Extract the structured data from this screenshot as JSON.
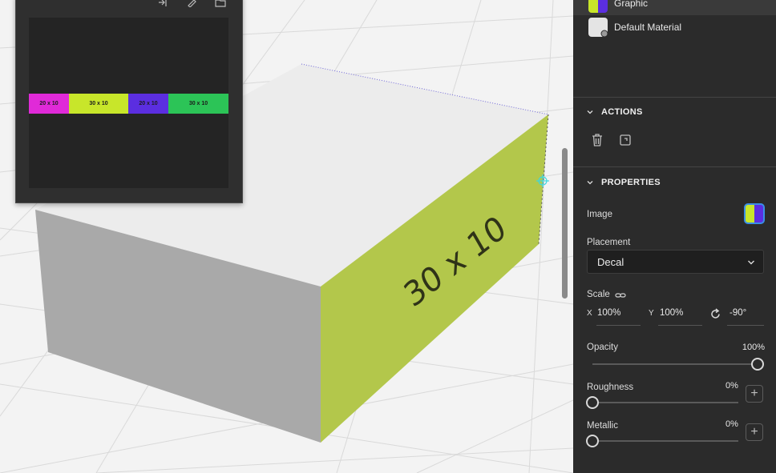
{
  "viewport": {
    "box_side_text": "30 x 10"
  },
  "texture_panel": {
    "strips": [
      {
        "label": "20 x 10",
        "color": "#e02ad8"
      },
      {
        "label": "30 x 10",
        "color": "#c8e62a"
      },
      {
        "label": "20 x 10",
        "color": "#5b2ee0"
      },
      {
        "label": "30 x 10",
        "color": "#2cc457"
      }
    ]
  },
  "materials": {
    "items": [
      {
        "label": "Graphic"
      },
      {
        "label": "Default Material"
      }
    ]
  },
  "actions": {
    "title": "ACTIONS"
  },
  "properties": {
    "title": "PROPERTIES",
    "image_label": "Image",
    "placement_label": "Placement",
    "placement_value": "Decal",
    "scale_label": "Scale",
    "x_label": "X",
    "x_value": "100%",
    "y_label": "Y",
    "y_value": "100%",
    "rotation_value": "-90°",
    "opacity_label": "Opacity",
    "opacity_value": "100%",
    "opacity_level": 1.0,
    "roughness_label": "Roughness",
    "roughness_value": "0%",
    "roughness_level": 0,
    "metallic_label": "Metallic",
    "metallic_value": "0%",
    "metallic_level": 0
  },
  "colors": {
    "panel_bg": "#2b2b2b",
    "accent_blue": "#3a8ee6",
    "decal_green": "#b2c84a"
  }
}
